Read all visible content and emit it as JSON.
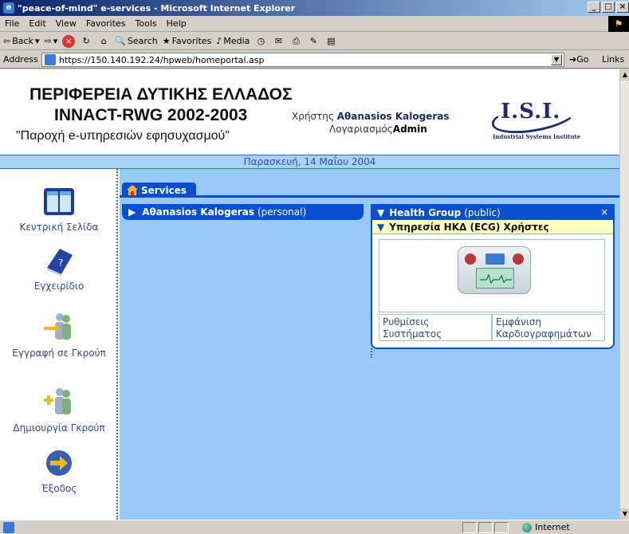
{
  "window": {
    "title": "\"peace-of-mind\" e-services - Microsoft Internet Explorer",
    "controls": [
      "_",
      "□",
      "×"
    ]
  },
  "menu": [
    "File",
    "Edit",
    "View",
    "Favorites",
    "Tools",
    "Help"
  ],
  "toolbar": {
    "back": "Back",
    "search": "Search",
    "favorites": "Favorites",
    "media": "Media"
  },
  "address": {
    "label": "Address",
    "url": "https://150.140.192.24/hpweb/homeportal.asp",
    "go": "Go",
    "links": "Links"
  },
  "page": {
    "header": {
      "line1": "ΠΕΡΙΦΕΡΕΙΑ ΔΥΤΙΚΗΣ ΕΛΛΑΔΟΣ",
      "line2": "INNACT-RWG 2002-2003",
      "line3": "\"Παροχή e-υπηρεσιών εφησυχασμού\"",
      "user_label": "Χρήστης ",
      "user_name": "Αθanasios Kalogeras",
      "account_label": "Λογαριασμός",
      "account_name": "Admin",
      "logo_text": "I.S.I.",
      "logo_sub": "Industrial Systems Institute"
    },
    "date": "Παρασκευή, 14 Μαΐου 2004",
    "nav": [
      {
        "label": "Κεντρική Σελίδα",
        "icon": "home-book-icon"
      },
      {
        "label": "Εγχειρίδιο",
        "icon": "manual-book-icon"
      },
      {
        "label": "Εγγραφή σε Γκρούπ",
        "icon": "join-group-icon"
      },
      {
        "label": "Δημιουργία Γκρούπ",
        "icon": "create-group-icon"
      },
      {
        "label": "Έξοδος",
        "icon": "exit-icon"
      }
    ],
    "tab": "Services",
    "personal_panel": {
      "name": "Αθanasios Kalogeras",
      "scope": "(personal)"
    },
    "group_panel": {
      "name": "Health Group",
      "scope": "(public)",
      "close": "×",
      "service_title": "Υπηρεσία ΗΚΔ (ECG) Χρήστες",
      "links": [
        "Ρυθμίσεις Συστήματος",
        "Εμφάνιση Καρδιογραφημάτων"
      ]
    }
  },
  "status": {
    "zone": "Internet"
  }
}
